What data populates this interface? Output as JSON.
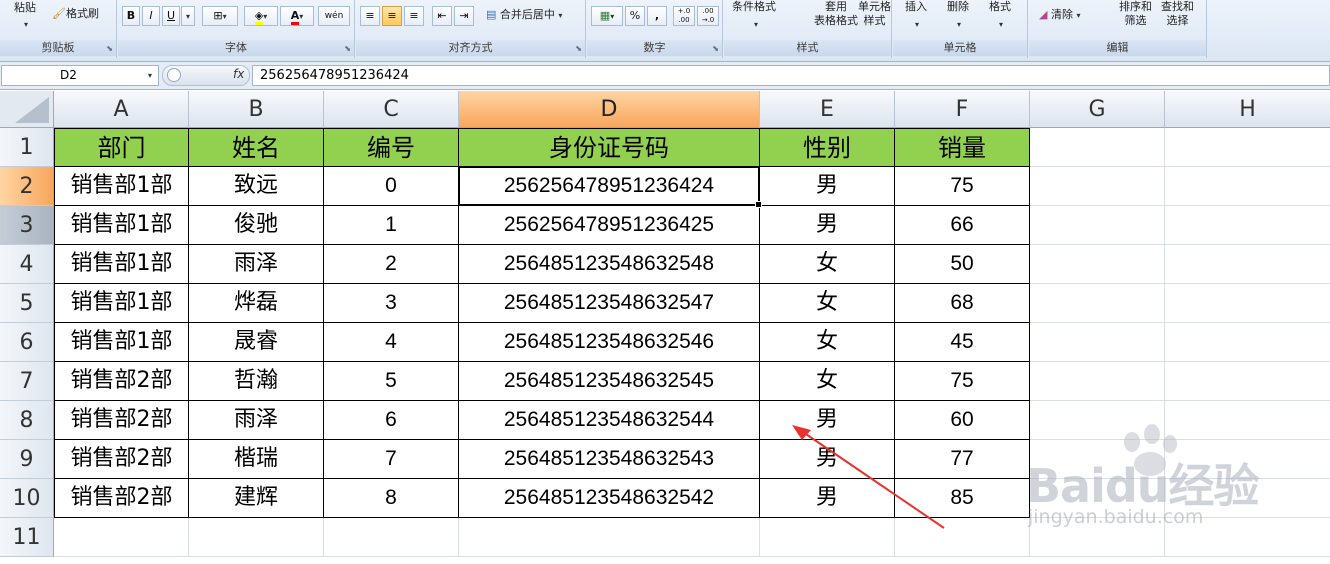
{
  "ribbon": {
    "clipboard": {
      "label": "剪贴板",
      "paste": "粘贴",
      "format_painter": "格式刷"
    },
    "font": {
      "label": "字体",
      "bold": "B",
      "italic": "I",
      "underline": "U",
      "font_color": "A",
      "phonetic": "wén"
    },
    "alignment": {
      "label": "对齐方式",
      "merge_center": "合并后居中"
    },
    "number": {
      "label": "数字",
      "percent": "%",
      "comma": ",",
      "inc_decimal": "+.0 .00",
      "dec_decimal": ".00 →.0"
    },
    "styles": {
      "label": "样式",
      "conditional": "条件格式",
      "table_format": "套用\n表格格式",
      "cell_styles": "单元格\n样式"
    },
    "cells": {
      "label": "单元格",
      "insert": "插入",
      "delete": "删除",
      "format": "格式"
    },
    "editing": {
      "label": "编辑",
      "clear": "清除",
      "sort_filter": "排序和\n筛选",
      "find_select": "查找和\n选择"
    }
  },
  "formula_bar": {
    "name_box": "D2",
    "fx": "fx",
    "value": "256256478951236424"
  },
  "columns": [
    "A",
    "B",
    "C",
    "D",
    "E",
    "F",
    "G",
    "H"
  ],
  "rows": [
    "1",
    "2",
    "3",
    "4",
    "5",
    "6",
    "7",
    "8",
    "9",
    "10",
    "11"
  ],
  "selected_cell": "D2",
  "table": {
    "headers": [
      "部门",
      "姓名",
      "编号",
      "身份证号码",
      "性别",
      "销量"
    ],
    "header_color": "#92d050",
    "rows": [
      [
        "销售部1部",
        "致远",
        "0",
        "256256478951236424",
        "男",
        "75"
      ],
      [
        "销售部1部",
        "俊驰",
        "1",
        "256256478951236425",
        "男",
        "66"
      ],
      [
        "销售部1部",
        "雨泽",
        "2",
        "256485123548632548",
        "女",
        "50"
      ],
      [
        "销售部1部",
        "烨磊",
        "3",
        "256485123548632547",
        "女",
        "68"
      ],
      [
        "销售部1部",
        "晟睿",
        "4",
        "256485123548632546",
        "女",
        "45"
      ],
      [
        "销售部2部",
        "哲瀚",
        "5",
        "256485123548632545",
        "女",
        "75"
      ],
      [
        "销售部2部",
        "雨泽",
        "6",
        "256485123548632544",
        "男",
        "60"
      ],
      [
        "销售部2部",
        "楷瑞",
        "7",
        "256485123548632543",
        "男",
        "77"
      ],
      [
        "销售部2部",
        "建辉",
        "8",
        "256485123548632542",
        "男",
        "85"
      ]
    ]
  },
  "annotation": {
    "arrow_color": "#e8322d"
  },
  "watermark": {
    "logo": "Baidu经验",
    "url": "jingyan.baidu.com"
  }
}
